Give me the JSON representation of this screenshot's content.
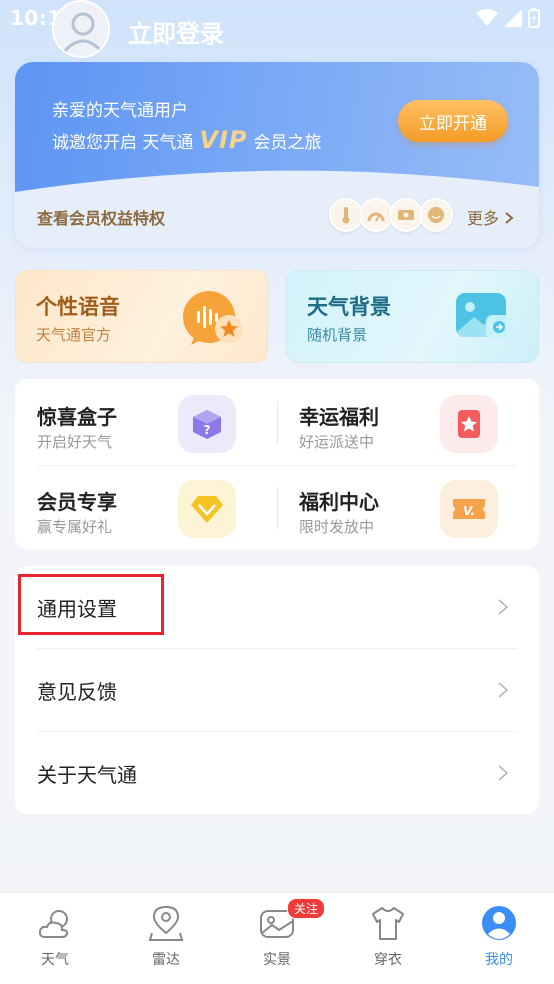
{
  "status_bar": {
    "time": "10:16"
  },
  "header": {
    "login_label": "立即登录"
  },
  "vip": {
    "line1": "亲爱的天气通用户",
    "line2_prefix": "诚邀您开启 天气通",
    "vip_mark": "VIP",
    "line2_suffix": "会员之旅",
    "open_button": "立即开通",
    "benefit_label": "查看会员权益特权",
    "more_label": "更多",
    "benefit_icons": [
      "thermometer-icon",
      "gauge-icon",
      "ticket-icon",
      "smile-icon"
    ]
  },
  "features": [
    {
      "title": "个性语音",
      "subtitle": "天气通官方",
      "icon": "voice-bubble-icon"
    },
    {
      "title": "天气背景",
      "subtitle": "随机背景",
      "icon": "image-icon"
    }
  ],
  "grid": [
    {
      "title": "惊喜盒子",
      "subtitle": "开启好天气",
      "icon": "mystery-box-icon"
    },
    {
      "title": "幸运福利",
      "subtitle": "好运派送中",
      "icon": "star-card-icon"
    },
    {
      "title": "会员专享",
      "subtitle": "赢专属好礼",
      "icon": "diamond-icon"
    },
    {
      "title": "福利中心",
      "subtitle": "限时发放中",
      "icon": "vip-ticket-icon"
    }
  ],
  "settings": [
    {
      "label": "通用设置"
    },
    {
      "label": "意见反馈"
    },
    {
      "label": "关于天气通"
    }
  ],
  "tabbar": {
    "items": [
      {
        "label": "天气",
        "icon": "weather-icon"
      },
      {
        "label": "雷达",
        "icon": "location-icon"
      },
      {
        "label": "实景",
        "icon": "photo-icon"
      },
      {
        "label": "穿衣",
        "icon": "shirt-icon"
      },
      {
        "label": "我的",
        "icon": "user-icon"
      }
    ],
    "active_index": 4,
    "badge": "关注"
  },
  "colors": {
    "accent": "#3a8ef6",
    "highlight": "#e8242d",
    "vip_orange": "#f39b25"
  }
}
